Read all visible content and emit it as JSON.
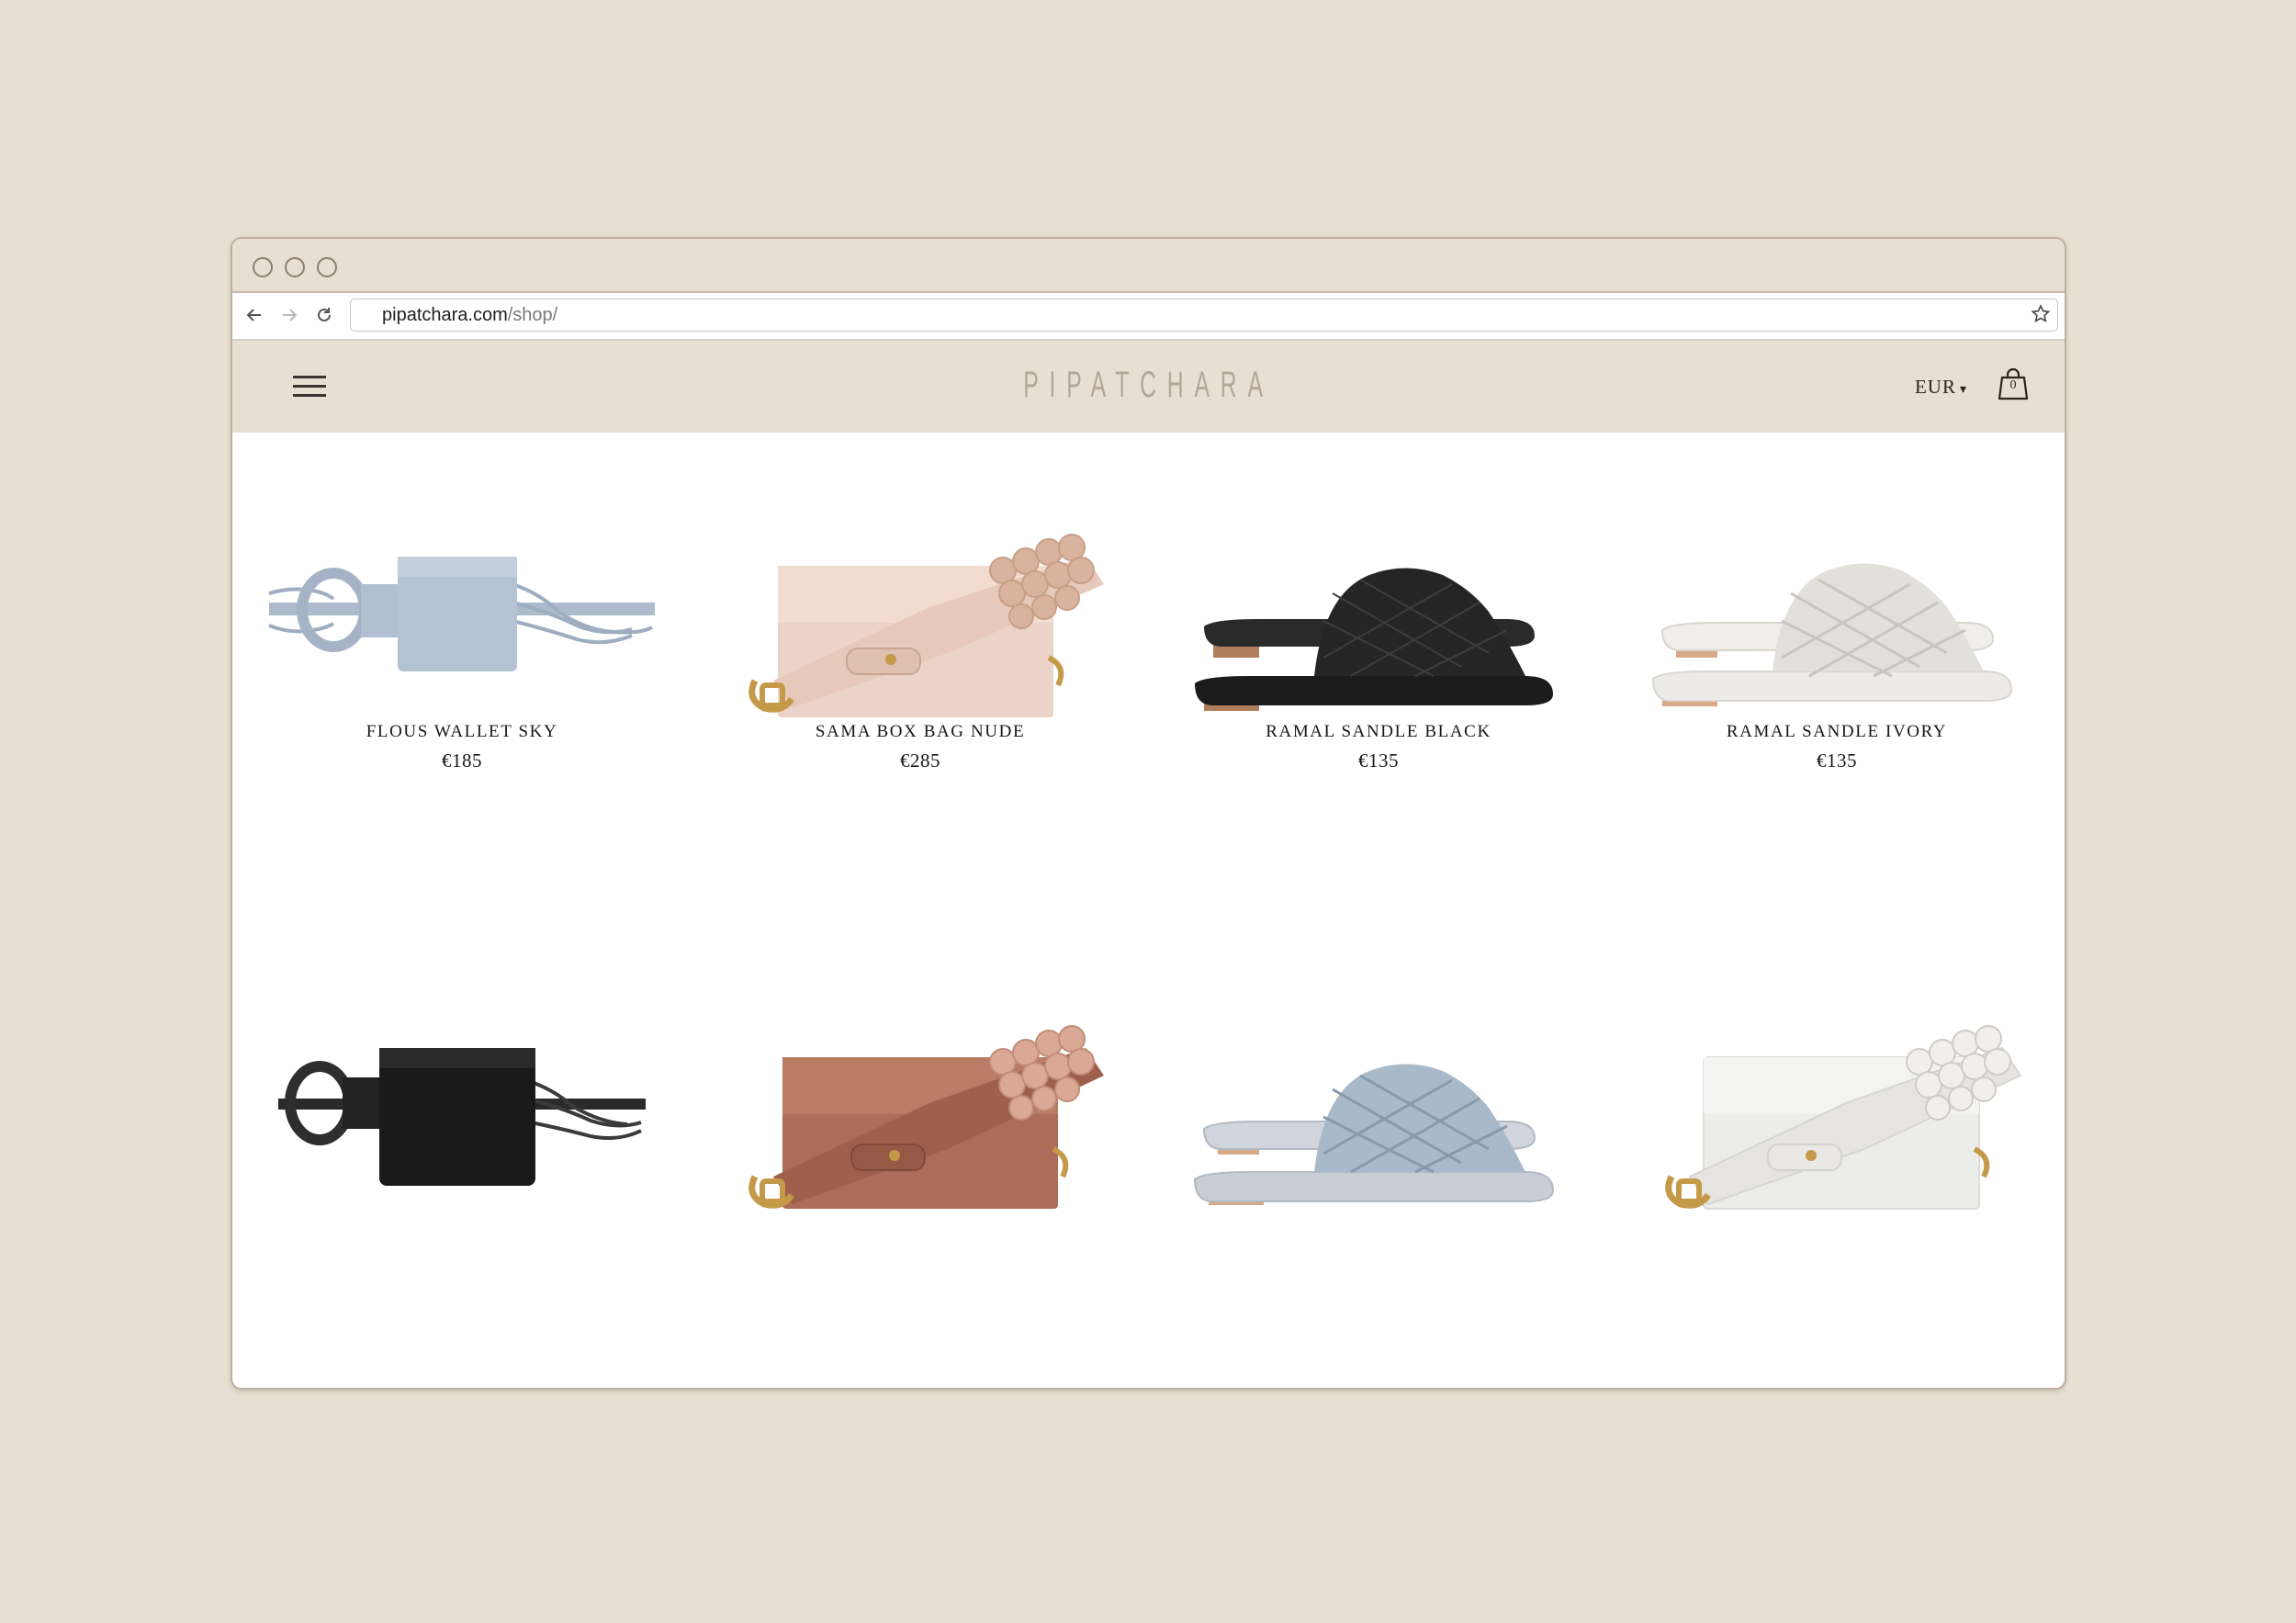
{
  "browser": {
    "url_domain": "pipatchara.com",
    "url_path": "/shop/"
  },
  "header": {
    "logo": "PIPATCHARA",
    "currency": "EUR",
    "currency_caret": "▾",
    "cart_count": "0"
  },
  "products": [
    {
      "name": "FLOUS WALLET SKY",
      "price": "€185",
      "icon": "belt-bag-sky"
    },
    {
      "name": "SAMA BOX BAG NUDE",
      "price": "€285",
      "icon": "box-bag-nude"
    },
    {
      "name": "RAMAL SANDLE BLACK",
      "price": "€135",
      "icon": "sandal-black"
    },
    {
      "name": "RAMAL SANDLE IVORY",
      "price": "€135",
      "icon": "sandal-ivory"
    },
    {
      "name": "",
      "price": "",
      "icon": "belt-bag-black"
    },
    {
      "name": "",
      "price": "",
      "icon": "box-bag-brown"
    },
    {
      "name": "",
      "price": "",
      "icon": "sandal-blue"
    },
    {
      "name": "",
      "price": "",
      "icon": "box-bag-white"
    }
  ],
  "colors": {
    "background": "#e7dfd3",
    "sky": "#a9b6c9",
    "nude": "#e9cfc3",
    "black": "#1e1e1e",
    "ivory": "#ece9e3",
    "brown": "#a86a55",
    "blue": "#a7b8c8",
    "white": "#ececea"
  }
}
